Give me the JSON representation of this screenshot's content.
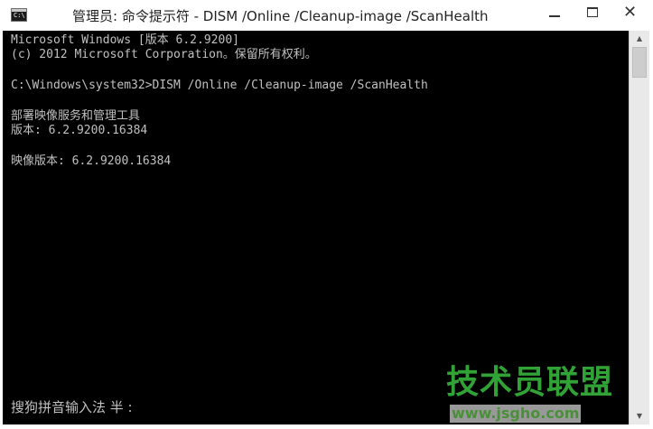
{
  "window": {
    "title": "管理员: 命令提示符 - DISM  /Online /Cleanup-image /ScanHealth",
    "icon_label": "C:\\",
    "icon": "cmd-icon",
    "controls": {
      "minimize_icon": "minimize-icon",
      "maximize_icon": "maximize-icon",
      "close_glyph": "✕"
    }
  },
  "console": {
    "lines": [
      "Microsoft Windows [版本 6.2.9200]",
      "(c) 2012 Microsoft Corporation。保留所有权利。",
      "",
      "C:\\Windows\\system32>DISM /Online /Cleanup-image /ScanHealth",
      "",
      "部署映像服务和管理工具",
      "版本: 6.2.9200.16384",
      "",
      "映像版本: 6.2.9200.16384"
    ],
    "ime_status": "搜狗拼音输入法 半 :",
    "text_color": "#c0c0c0",
    "background": "#000000"
  },
  "scrollbar": {
    "up_arrow": "▲",
    "down_arrow": "▼"
  },
  "watermark": {
    "name": "技术员联盟",
    "url": "www.jsgho.com"
  }
}
